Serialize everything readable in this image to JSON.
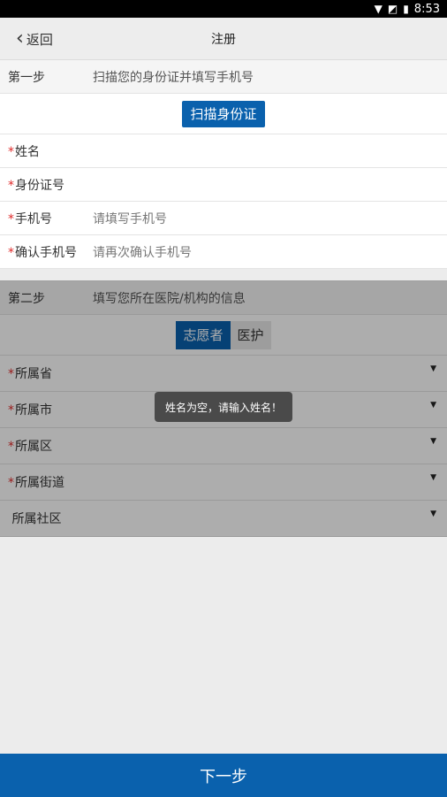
{
  "status": {
    "time": "8:53",
    "icons": [
      "wifi-icon",
      "no-signal-icon",
      "battery-icon"
    ]
  },
  "header": {
    "back_label": "返回",
    "title": "注册"
  },
  "step1": {
    "step_label": "第一步",
    "hint": "扫描您的身份证并填写手机号",
    "scan_button": "扫描身份证",
    "fields": [
      {
        "label": "姓名",
        "required": "*",
        "placeholder": ""
      },
      {
        "label": "身份证号",
        "required": "*",
        "placeholder": ""
      },
      {
        "label": "手机号",
        "required": "*",
        "placeholder": "请填写手机号"
      },
      {
        "label": "确认手机号",
        "required": "*",
        "placeholder": "请再次确认手机号"
      }
    ]
  },
  "step2": {
    "step_label": "第二步",
    "hint": "填写您所在医院/机构的信息",
    "segments": [
      "志愿者",
      "医护"
    ],
    "selected_segment": "志愿者",
    "selects": [
      {
        "label": "所属省",
        "required": "*"
      },
      {
        "label": "所属市",
        "required": "*"
      },
      {
        "label": "所属区",
        "required": "*"
      },
      {
        "label": "所属街道",
        "required": "*"
      },
      {
        "label": "所属社区",
        "required": ""
      }
    ]
  },
  "toast": {
    "message": "姓名为空，请输入姓名！"
  },
  "footer": {
    "next_label": "下一步"
  },
  "colors": {
    "primary": "#0a61ad",
    "required": "#e02b2b"
  }
}
